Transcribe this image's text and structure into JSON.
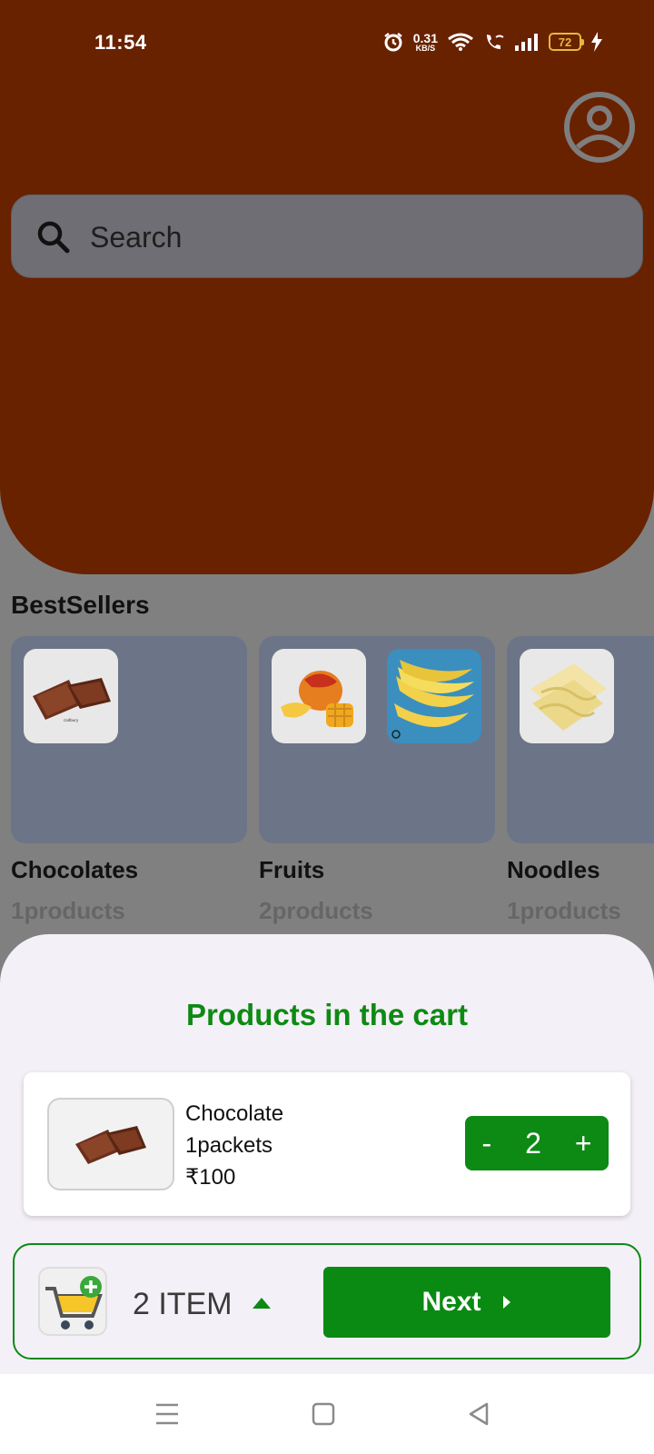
{
  "status": {
    "time": "11:54",
    "net_speed": "0.31",
    "net_unit": "KB/S",
    "battery": "72"
  },
  "search": {
    "placeholder": "Search"
  },
  "bestsellers": {
    "title": "BestSellers",
    "items": [
      {
        "name": "Chocolates",
        "count": "1products"
      },
      {
        "name": "Fruits",
        "count": "2products"
      },
      {
        "name": "Noodles",
        "count": "1products"
      }
    ]
  },
  "cart": {
    "title": "Products in the cart",
    "item": {
      "name": "Chocolate",
      "unit": "1packets",
      "price": "₹100",
      "qty": "2"
    },
    "stepper": {
      "minus": "-",
      "plus": "+"
    },
    "summary": "2 ITEM",
    "next_label": "Next"
  },
  "colors": {
    "accent_green": "#0d8a14",
    "header": "#682200"
  },
  "icons": [
    "alarm-icon",
    "wifi-icon",
    "wifi-call-icon",
    "signal-icon",
    "battery-icon",
    "charging-icon",
    "profile-icon",
    "search-icon",
    "cart-add-icon",
    "caret-up-icon",
    "chevron-right-icon",
    "menu-icon",
    "home-icon",
    "back-icon"
  ]
}
